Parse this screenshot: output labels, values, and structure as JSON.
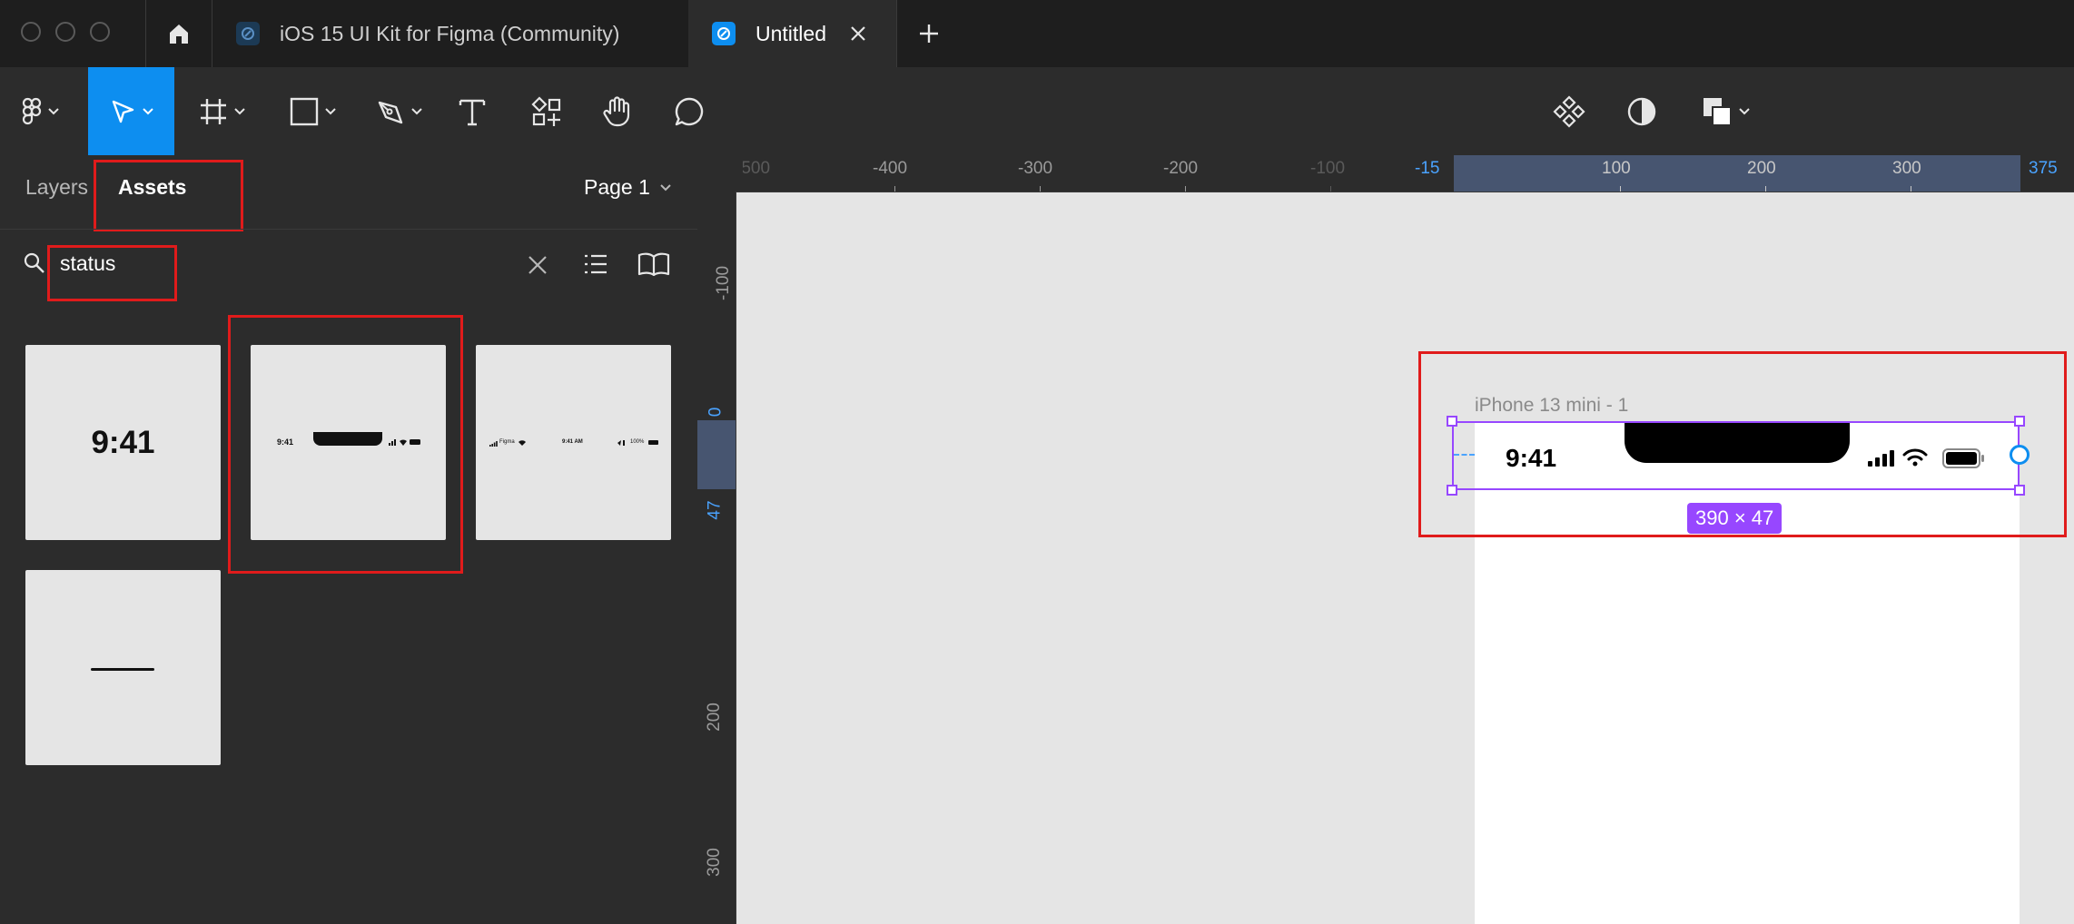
{
  "window": {
    "tabs": [
      {
        "label": "iOS 15 UI Kit for Figma (Community)",
        "active": false
      },
      {
        "label": "Untitled",
        "active": true
      }
    ]
  },
  "toolbar": {
    "tools": [
      "figma-menu-icon",
      "move-tool-icon",
      "frame-tool-icon",
      "rectangle-tool-icon",
      "pen-tool-icon",
      "text-tool-icon",
      "resources-icon",
      "hand-tool-icon",
      "comment-tool-icon"
    ],
    "right_tools": [
      "components-icon",
      "contrast-icon",
      "boolean-ops-icon"
    ]
  },
  "left_panel": {
    "tabs": {
      "layers": "Layers",
      "assets": "Assets"
    },
    "page_selector": "Page 1",
    "search": {
      "value": "status"
    },
    "assets": [
      {
        "id": "time",
        "text": "9:41"
      },
      {
        "id": "status-bar-iphone",
        "left": "9:41"
      },
      {
        "id": "status-bar-ipad",
        "left": "Figma",
        "center": "9:41 AM",
        "right": "100%"
      },
      {
        "id": "home-indicator"
      }
    ]
  },
  "rulers": {
    "top": [
      "-500",
      "-400",
      "-300",
      "-200",
      "-100",
      "-15",
      "100",
      "200",
      "300",
      "375"
    ],
    "left": [
      "-100",
      "0",
      "47",
      "200",
      "300"
    ]
  },
  "canvas": {
    "frame_label": "iPhone 13 mini - 1",
    "status_bar_time": "9:41",
    "selection_size": "390 × 47"
  },
  "colors": {
    "accent": "#0d8ef0",
    "selection": "#9747ff",
    "highlight": "#e01b1b",
    "canvas": "#e5e5e5",
    "panel": "#2c2c2c"
  }
}
